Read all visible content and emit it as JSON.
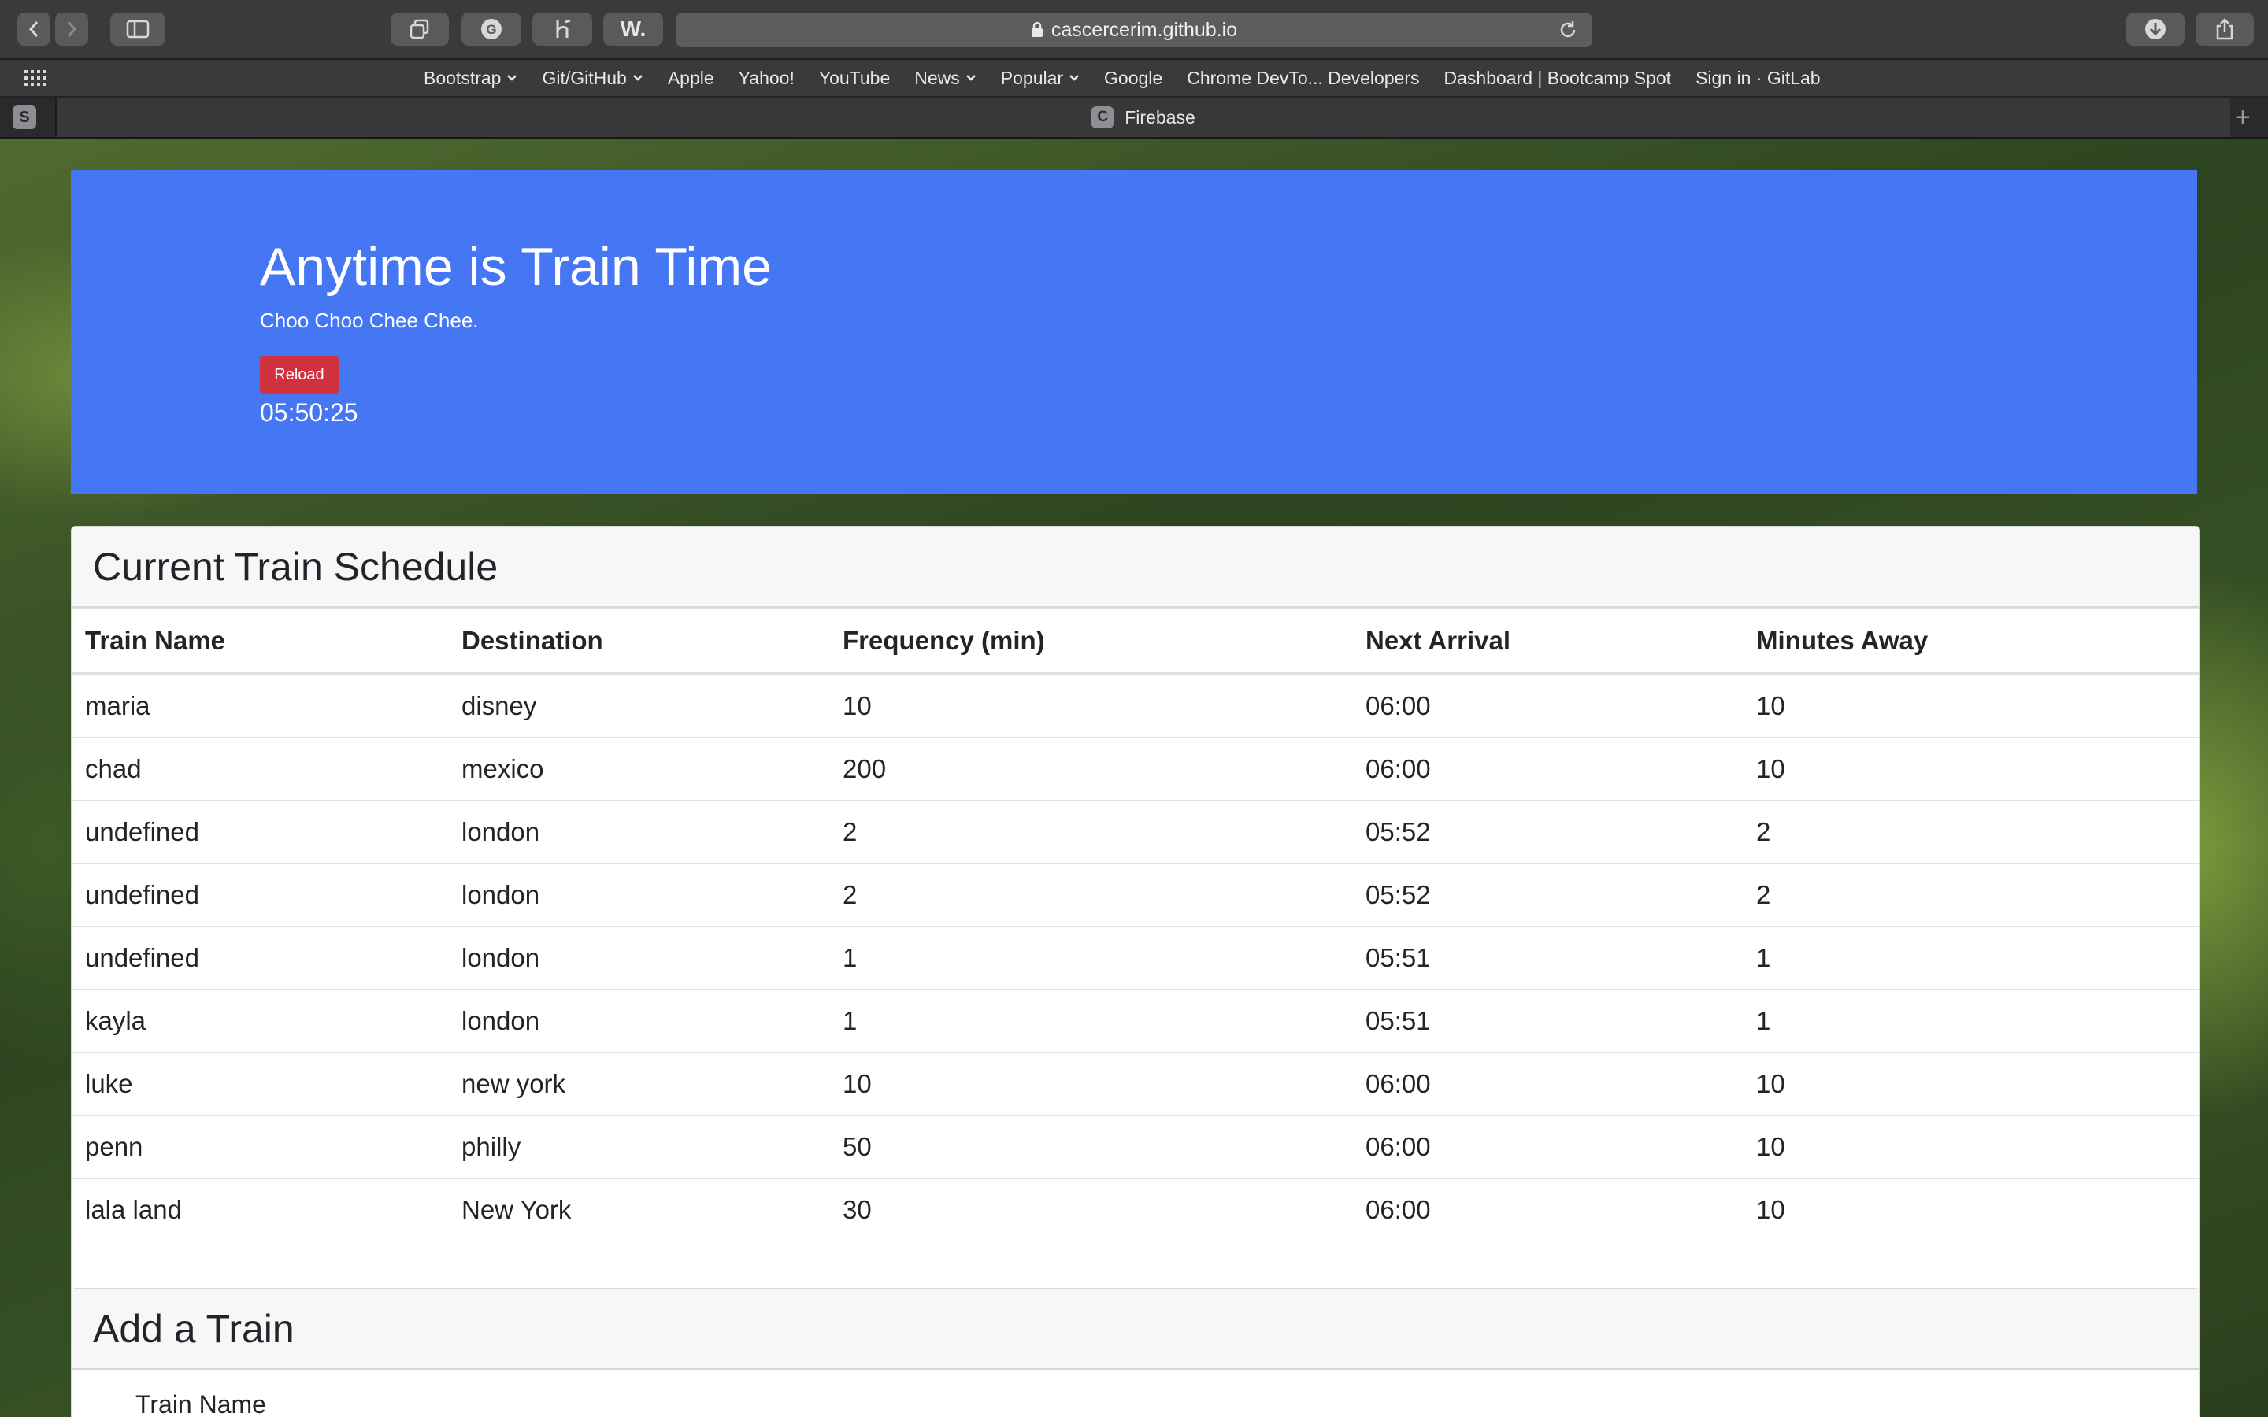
{
  "browser": {
    "url": "cascercerim.github.io",
    "bookmarks": [
      {
        "label": "Bootstrap",
        "menu": true
      },
      {
        "label": "Git/GitHub",
        "menu": true
      },
      {
        "label": "Apple",
        "menu": false
      },
      {
        "label": "Yahoo!",
        "menu": false
      },
      {
        "label": "YouTube",
        "menu": false
      },
      {
        "label": "News",
        "menu": true
      },
      {
        "label": "Popular",
        "menu": true
      },
      {
        "label": "Google",
        "menu": false
      },
      {
        "label": "Chrome DevTo... Developers",
        "menu": false
      },
      {
        "label": "Dashboard | Bootcamp Spot",
        "menu": false
      },
      {
        "label": "Sign in · GitLab",
        "menu": false
      }
    ],
    "pinned_tab_letter": "S",
    "tab": {
      "favicon_letter": "C",
      "title": "Firebase"
    },
    "toolbar_icons": [
      "back-icon",
      "forward-icon",
      "sidebar-icon",
      "tabs-overview-icon",
      "grammarly-icon",
      "extension-icon",
      "w-extension-icon",
      "download-icon",
      "share-icon"
    ]
  },
  "jumbotron": {
    "title": "Anytime is Train Time",
    "subtitle": "Choo Choo Chee Chee.",
    "reload_label": "Reload",
    "clock": "05:50:25"
  },
  "schedule": {
    "title": "Current Train Schedule",
    "columns": [
      "Train Name",
      "Destination",
      "Frequency (min)",
      "Next Arrival",
      "Minutes Away"
    ],
    "rows": [
      [
        "maria",
        "disney",
        "10",
        "06:00",
        "10"
      ],
      [
        "chad",
        "mexico",
        "200",
        "06:00",
        "10"
      ],
      [
        "undefined",
        "london",
        "2",
        "05:52",
        "2"
      ],
      [
        "undefined",
        "london",
        "2",
        "05:52",
        "2"
      ],
      [
        "undefined",
        "london",
        "1",
        "05:51",
        "1"
      ],
      [
        "kayla",
        "london",
        "1",
        "05:51",
        "1"
      ],
      [
        "luke",
        "new york",
        "10",
        "06:00",
        "10"
      ],
      [
        "penn",
        "philly",
        "50",
        "06:00",
        "10"
      ],
      [
        "lala land",
        "New York",
        "30",
        "06:00",
        "10"
      ]
    ]
  },
  "add_train": {
    "title": "Add a Train",
    "train_name_label": "Train Name"
  },
  "colors": {
    "jumbotron": "#4577f5",
    "reload_button": "#d0313f",
    "browser_chrome": "#3a3a3c"
  }
}
